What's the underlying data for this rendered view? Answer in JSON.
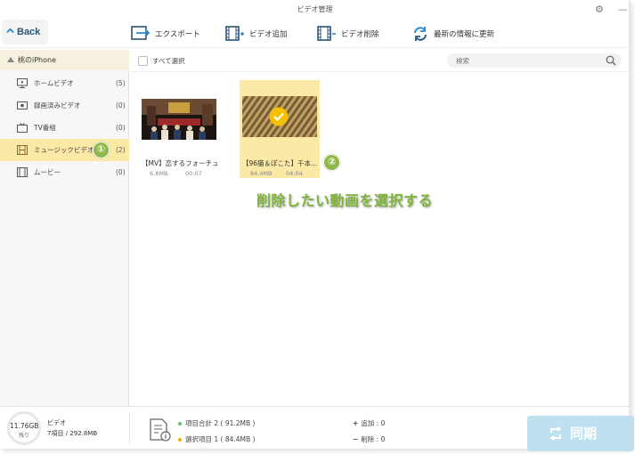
{
  "window": {
    "title": "ビデオ管理"
  },
  "toolbar": {
    "back_label": "Back",
    "export_label": "エクスポート",
    "add_label": "ビデオ追加",
    "delete_label": "ビデオ削除",
    "refresh_label": "最新の情報に更新"
  },
  "sidebar": {
    "device_name": "桃のiPhone",
    "items": [
      {
        "label": "ホームビデオ",
        "count": "(5)",
        "icon": "monitor-icon"
      },
      {
        "label": "録画済みビデオ",
        "count": "(0)",
        "icon": "record-icon"
      },
      {
        "label": "TV番組",
        "count": "(0)",
        "icon": "tv-icon"
      },
      {
        "label": "ミュージックビデオ",
        "count": "(2)",
        "icon": "music-video-icon"
      },
      {
        "label": "ムービー",
        "count": "(0)",
        "icon": "film-icon"
      }
    ]
  },
  "main": {
    "select_all_label": "すべて選択",
    "search_placeholder": "検索",
    "videos": [
      {
        "title": "【MV】恋するフォーチュン...",
        "size": "6.8MB",
        "duration": "00:07"
      },
      {
        "title": "【96猫＆ぽこた】千本...",
        "size": "84.4MB",
        "duration": "04:04"
      }
    ],
    "annotation": "削除したい動画を選択する",
    "badge_1": "①",
    "badge_2": "②"
  },
  "bottom": {
    "storage_size": "11.76GB",
    "storage_sub": "残り",
    "storage_type": "ビデオ",
    "storage_count": "7項目 / 292.8MB",
    "total_label": "項目合計 2 ( 91.2MB )",
    "selected_label": "選択項目 1 ( 84.4MB )",
    "add_label": "追加 :  0",
    "delete_label": "削除 :  0",
    "sync_label": "同期"
  },
  "colors": {
    "accent_yellow": "#fbe9a6",
    "badge_green": "#8fb94a",
    "annotation_green": "#7fb33a",
    "sync_blue": "#bfe1ef",
    "icon_blue": "#2a5478"
  }
}
